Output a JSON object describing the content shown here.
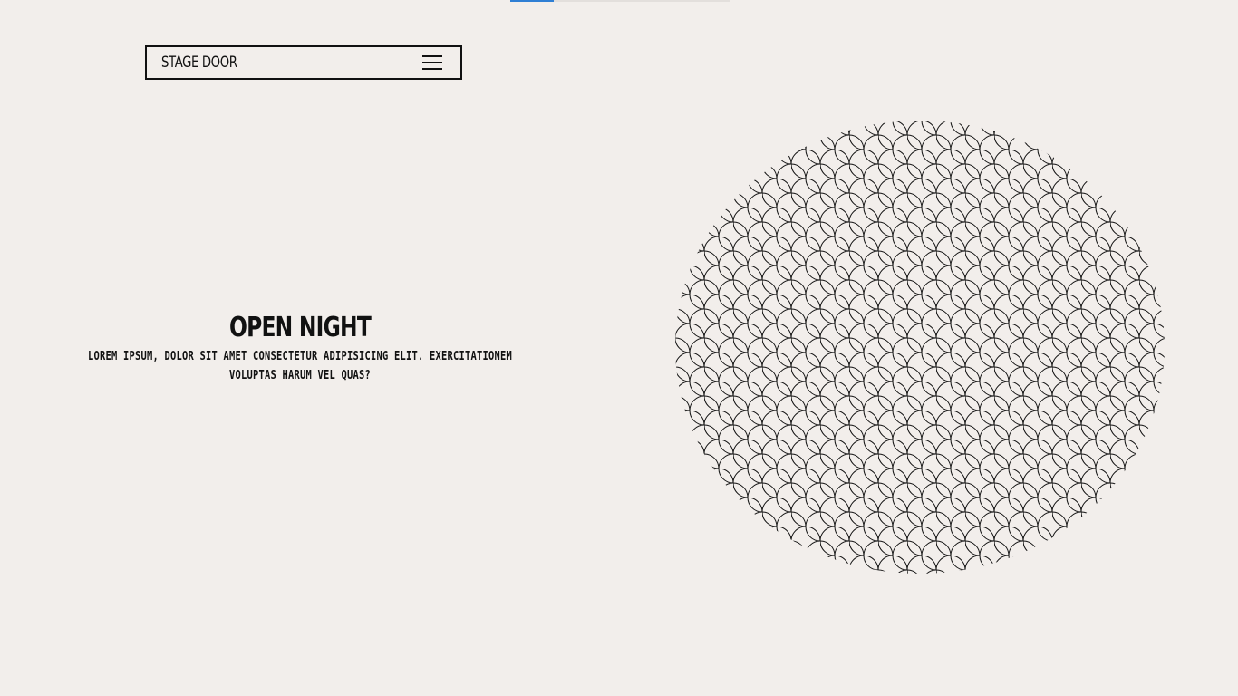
{
  "progress": {
    "value": 0.2,
    "fill_color": "#2f7fd4",
    "track_color": "#e3dfdc"
  },
  "navbar": {
    "brand": "STAGE DOOR",
    "menu_icon": "hamburger-menu-icon"
  },
  "hero": {
    "title": "OPEN NIGHT",
    "description": "LOREM IPSUM, DOLOR SIT AMET CONSECTETUR ADIPISICING ELIT. EXERCITATIONEM VOLUPTAS HARUM VEL QUAS?"
  },
  "decoration": {
    "pattern": "fish-scale-circle",
    "stroke_color": "#111111",
    "background_color": "#f2eeeb"
  }
}
